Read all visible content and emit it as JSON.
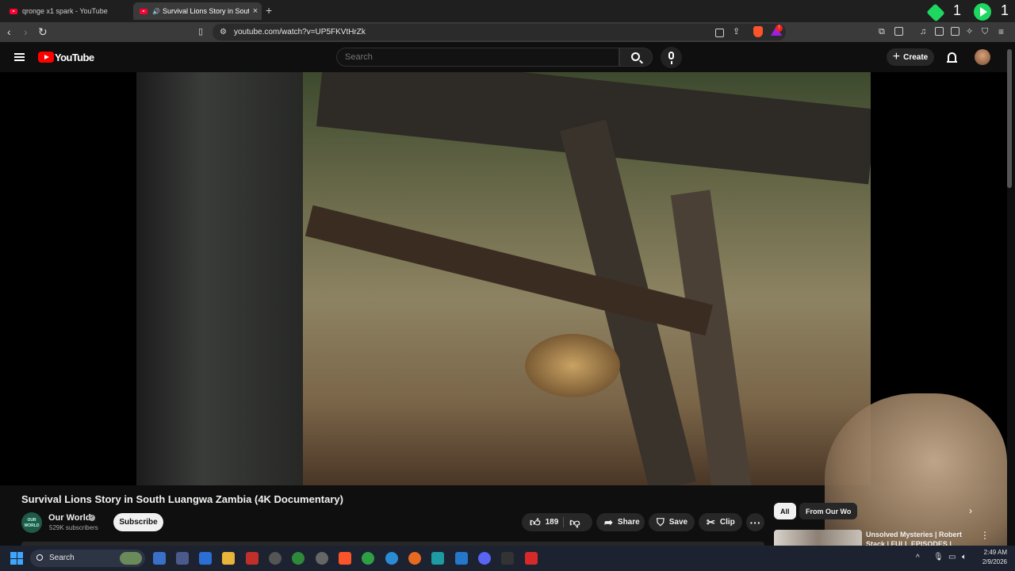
{
  "browser": {
    "tabs": [
      {
        "label": "qronge x1 spark - YouTube",
        "active": false
      },
      {
        "label": "Survival Lions Story in South L",
        "active": true,
        "close": "×"
      }
    ],
    "new_tab": "+",
    "url": "youtube.com/watch?v=UP5FKVtHrZk",
    "extension_counts": [
      "1",
      "1"
    ]
  },
  "youtube": {
    "logo_text": "YouTube",
    "search_placeholder": "Search",
    "create_label": "Create"
  },
  "video": {
    "title": "Survival Lions Story in South Luangwa Zambia (4K Documentary)",
    "channel": {
      "avatar_text": "OUR WORLD",
      "name": "Our World",
      "subscribers": "529K subscribers",
      "subscribe_label": "Subscribe"
    },
    "actions": {
      "like_count": "189",
      "share_label": "Share",
      "save_label": "Save",
      "clip_label": "Clip",
      "more_label": "···"
    }
  },
  "sidebar": {
    "chips": [
      {
        "label": "All",
        "selected": true
      },
      {
        "label": "From Our Wo",
        "selected": false
      }
    ],
    "next": "›",
    "recommendation": {
      "title": "Unsolved Mysteries | Robert Stack | FULL EPISODES |"
    }
  },
  "taskbar": {
    "search_label": "Search",
    "time": "2:49 AM",
    "date": "2/9/2026"
  },
  "colors": {
    "yt_red": "#ff0000",
    "accent_green": "#1ed760",
    "brave_orange": "#fb542b"
  }
}
